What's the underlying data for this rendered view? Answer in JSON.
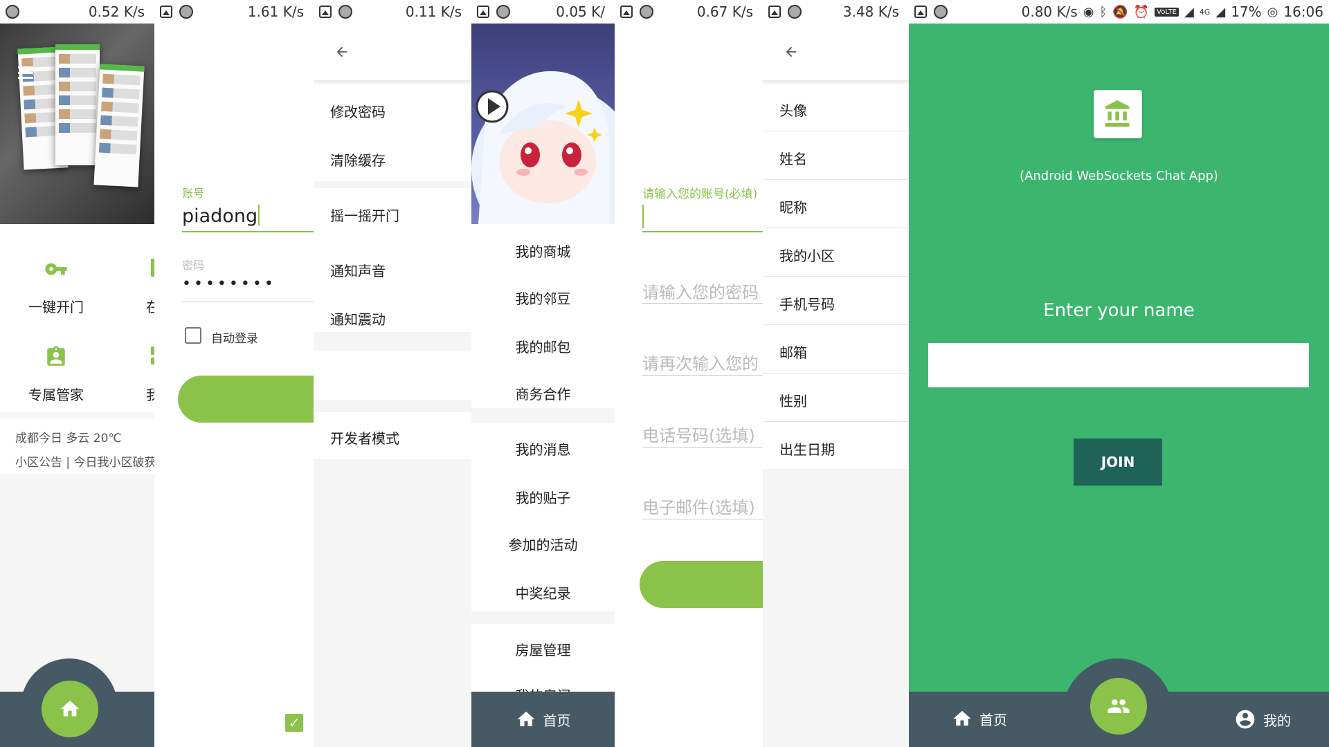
{
  "status_bars": {
    "p1": "0.52 K/s",
    "p2": "1.61 K/s",
    "p3": "0.11 K/s",
    "p4": "0.05 K/",
    "p5": "0.67 K/s",
    "p6": "3.48 K/s",
    "p7_speed": "0.80 K/s",
    "p7_network": "4G",
    "p7_volte": "VoLTE",
    "p7_battery": "17%",
    "p7_time": "16:06"
  },
  "home": {
    "grid": [
      {
        "label": "一键开门",
        "icon": "key-icon"
      },
      {
        "label": "在线",
        "icon": "green-tile-icon"
      },
      {
        "label": "专属管家",
        "icon": "badge-icon"
      },
      {
        "label": "我的",
        "icon": "green-tile-icon"
      }
    ],
    "weather": "成都今日  多云  20℃",
    "notice": "小区公告 | 今日我小区破获"
  },
  "login": {
    "account_label": "账号",
    "account_value": "piadong",
    "password_label": "密码",
    "password_value": "••••••••",
    "auto_login_label": "自动登录"
  },
  "settings": {
    "items": [
      "修改密码",
      "清除缓存",
      "摇一摇开门",
      "通知声音",
      "通知震动",
      "开发者模式"
    ]
  },
  "drawer": {
    "items": [
      "我的商城",
      "我的邻豆",
      "我的邮包",
      "商务合作",
      "我的消息",
      "我的贴子",
      "参加的活动",
      "中奖纪录",
      "房屋管理",
      "我的房间"
    ],
    "nav_home": "首页"
  },
  "register": {
    "account_label": "请输入您的账号(必填)",
    "password_placeholder": "请输入您的密码",
    "password_confirm_placeholder": "请再次输入您的",
    "phone_placeholder": "电话号码(选填)",
    "email_placeholder": "电子邮件(选填)"
  },
  "profile": {
    "items": [
      "头像",
      "姓名",
      "昵称",
      "我的小区",
      "手机号码",
      "邮箱",
      "性别",
      "出生日期"
    ]
  },
  "chat": {
    "subtitle": "(Android WebSockets Chat App)",
    "prompt": "Enter your name",
    "join_label": "JOIN",
    "nav_home": "首页",
    "nav_mine": "我的"
  },
  "colors": {
    "accent_green": "#8bc34a",
    "chat_bg": "#3cb66f",
    "join_btn": "#1e6356",
    "nav_bar": "#455a64"
  }
}
